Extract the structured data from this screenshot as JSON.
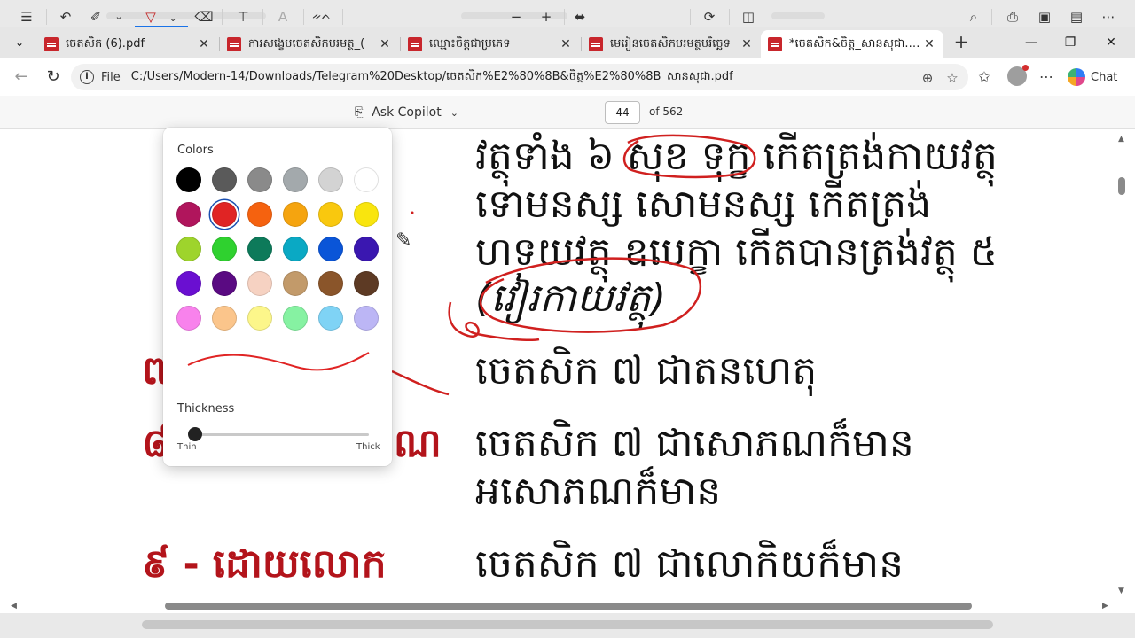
{
  "tabs": [
    {
      "title": "ចេតសិក (6).pdf",
      "active": false
    },
    {
      "title": "ការសង្ខេបចេតសិកបរមត្ថ_(",
      "active": false
    },
    {
      "title": "ឈ្មោះចិត្តជាប្រភេទ",
      "active": false
    },
    {
      "title": "មេរៀនចេតសិកបរមត្ថបរិច្ឆេទ",
      "active": false
    },
    {
      "title": "*ចេតសិក&ចិត្ត_សានសុជា.pdf",
      "active": true
    }
  ],
  "address": {
    "scheme_label": "File",
    "url": "C:/Users/Modern-14/Downloads/Telegram%20Desktop/ចេតសិក%E2%80%8B&ចិត្ត%E2%80%8B_សានសុជា.pdf"
  },
  "chat_label": "Chat",
  "pdf_toolbar": {
    "copilot_label": "Ask Copilot",
    "page_current": "44",
    "page_total": "of 562",
    "text_icon_label": "ᨀᨈ"
  },
  "colors_panel": {
    "title": "Colors",
    "thickness_label": "Thickness",
    "thin_label": "Thin",
    "thick_label": "Thick",
    "selected_color": "#e02424",
    "thickness": 0.05,
    "swatches": [
      [
        "#000000",
        "#5a5a5a",
        "#8a8a8a",
        "#a3a9ac",
        "#d3d3d3",
        "#ffffff"
      ],
      [
        "#b0155c",
        "#e02424",
        "#f5620f",
        "#f5a40f",
        "#f9c80e",
        "#f9e50e"
      ],
      [
        "#9ed42c",
        "#2fd12f",
        "#0d7a5a",
        "#0aa9c4",
        "#0a55d8",
        "#3a17b0"
      ],
      [
        "#6a0fd1",
        "#5a0a82",
        "#f6d2c2",
        "#c29a6a",
        "#8a552a",
        "#5d3a24"
      ],
      [
        "#f882ec",
        "#fbc58b",
        "#fcf68a",
        "#86f2a2",
        "#7fd3f5",
        "#bcb6f5"
      ]
    ]
  },
  "document": {
    "line1": "វត្ថុទាំង ៦ សុខ ទុក្ខ កើតត្រង់កាយវត្ថុ",
    "line2": "ទោមនស្ស សោមនស្ស កើតត្រង់",
    "line3": "ហទយវត្ថុ ឧបេក្ខា កើតបានត្រង់វត្ថុ ៥",
    "line4": "(វៀរកាយវត្ថុ)",
    "row7_label": "៧",
    "row7_text": "ចេតសិក ៧ ជាតនហេតុ",
    "row8_label": "៨",
    "row8_label_tail": "ណ",
    "row8_text": "ចេតសិក ៧ ជាសោភណក៏មាន",
    "row8_text2": "អសោភណក៏មាន",
    "row9_label": "៩ - ដោយលោក",
    "row9_text": "ចេតសិក ៧ ជាលោកិយក៏មាន"
  }
}
